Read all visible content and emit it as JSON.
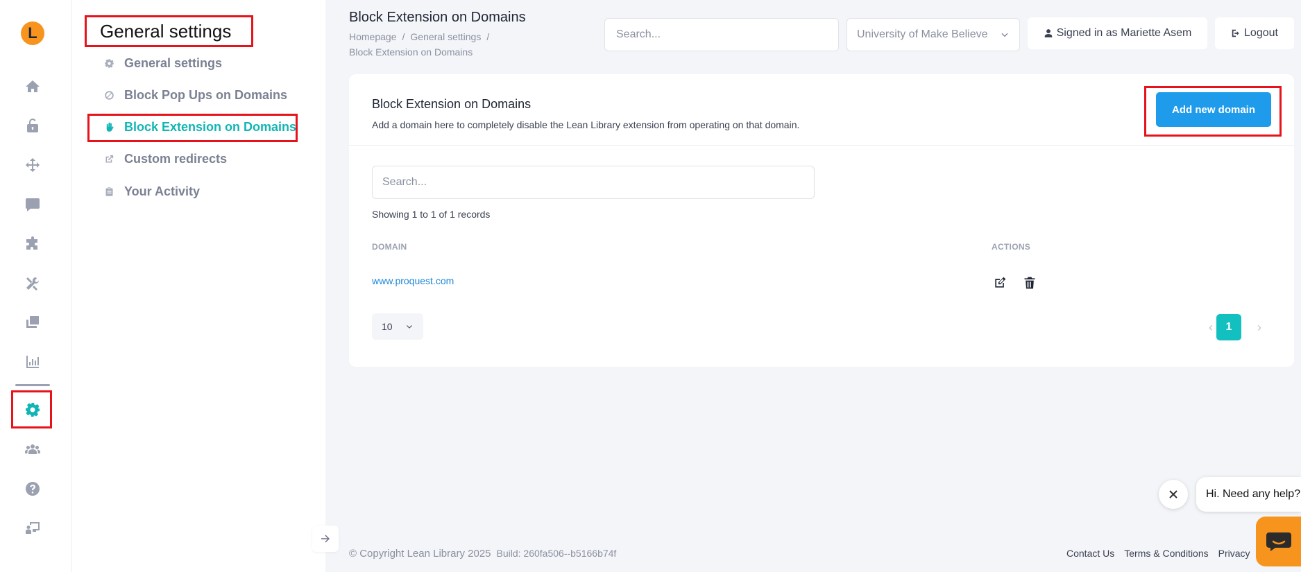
{
  "rail": {
    "logo_letter": "L",
    "icons": [
      "home-icon",
      "unlock-icon",
      "arrows-icon",
      "chat-icon",
      "puzzle-icon",
      "tools-icon",
      "windows-icon",
      "bar-chart-icon",
      "gear-icon",
      "users-icon",
      "help-icon",
      "presenter-icon"
    ],
    "active": "gear-icon",
    "active_color": "#12b5b5"
  },
  "subnav": {
    "title": "General settings",
    "items": [
      {
        "label": "General settings",
        "icon": "gear-icon"
      },
      {
        "label": "Block Pop Ups on Domains",
        "icon": "ban-icon"
      },
      {
        "label": "Block Extension on Domains",
        "icon": "hand-icon",
        "active": true
      },
      {
        "label": "Custom redirects",
        "icon": "external-link-icon"
      },
      {
        "label": "Your Activity",
        "icon": "clipboard-icon"
      }
    ]
  },
  "header": {
    "title": "Block Extension on Domains",
    "breadcrumbs": [
      "Homepage",
      "/",
      "General settings",
      "/",
      "Block Extension on Domains"
    ],
    "search_placeholder": "Search...",
    "organization": "University of Make Believe",
    "signed_in": "Signed in as Mariette Asem",
    "logout": "Logout"
  },
  "card": {
    "title": "Block Extension on Domains",
    "description": "Add a domain here to completely disable the Lean Library extension from operating on that domain.",
    "add_button": "Add new domain",
    "search_placeholder": "Search...",
    "records_text": "Showing 1 to 1 of 1 records",
    "columns": [
      "DOMAIN",
      "ACTIONS"
    ],
    "rows": [
      {
        "domain": "www.proquest.com"
      }
    ],
    "per_page": "10",
    "pagination": {
      "prev": "‹",
      "current": "1",
      "next": "›"
    }
  },
  "footer": {
    "copyright": "© Copyright Lean Library 2025",
    "build": "Build: 260fa506--b5166b74f",
    "links": [
      "Contact Us",
      "Terms & Conditions",
      "Privacy"
    ]
  },
  "chat": {
    "greeting": "Hi. Need any help?"
  },
  "colors": {
    "brand_orange": "#f7941d",
    "accent_teal": "#12b5b5",
    "primary_blue": "#1e9bea",
    "highlight_red": "#e8121b"
  }
}
